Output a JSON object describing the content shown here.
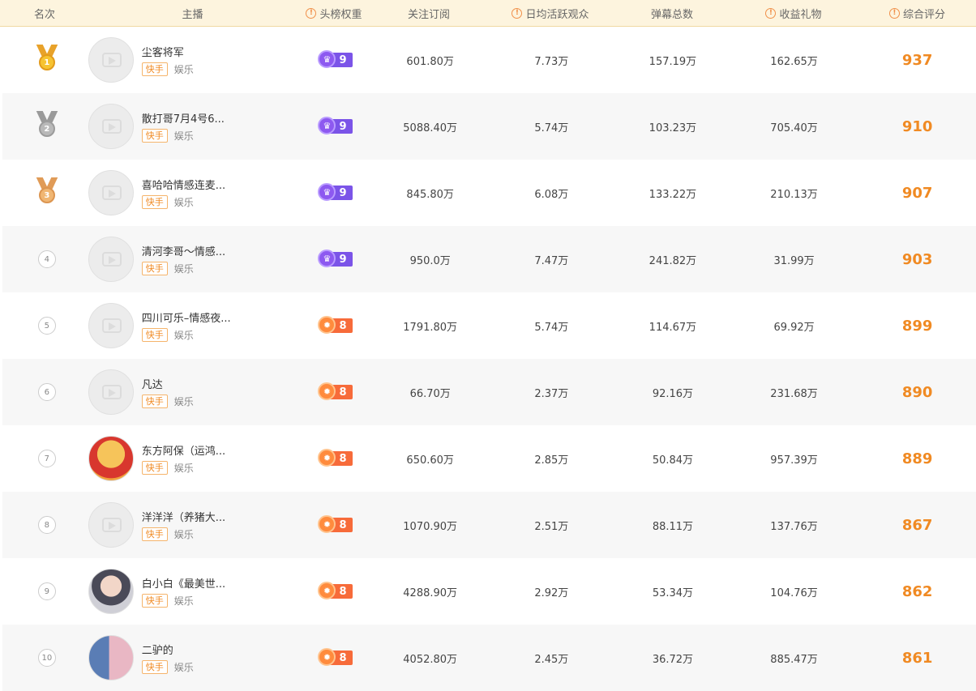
{
  "header": {
    "rank": "名次",
    "anchor": "主播",
    "weight": "头榜权重",
    "follow": "关注订阅",
    "daily": "日均活跃观众",
    "barrage": "弹幕总数",
    "income": "收益礼物",
    "score": "综合评分"
  },
  "colors": {
    "accent": "#f08a23",
    "header_bg": "#fdf4de",
    "badge_purple": "#7b54e8",
    "badge_orange": "#f76b3a",
    "gold": "#f2a823",
    "silver": "#a3a3a3",
    "bronze": "#eaa764"
  },
  "rows": [
    {
      "rank": "1",
      "name": "尘客将军",
      "platform": "快手",
      "category": "娱乐",
      "weight": "9",
      "follow": "601.80万",
      "daily": "7.73万",
      "barrage": "157.19万",
      "income": "162.65万",
      "score": "937"
    },
    {
      "rank": "2",
      "name": "散打哥7月4号6...",
      "platform": "快手",
      "category": "娱乐",
      "weight": "9",
      "follow": "5088.40万",
      "daily": "5.74万",
      "barrage": "103.23万",
      "income": "705.40万",
      "score": "910"
    },
    {
      "rank": "3",
      "name": "喜哈哈情感连麦...",
      "platform": "快手",
      "category": "娱乐",
      "weight": "9",
      "follow": "845.80万",
      "daily": "6.08万",
      "barrage": "133.22万",
      "income": "210.13万",
      "score": "907"
    },
    {
      "rank": "4",
      "name": "清河李哥～情感...",
      "platform": "快手",
      "category": "娱乐",
      "weight": "9",
      "follow": "950.0万",
      "daily": "7.47万",
      "barrage": "241.82万",
      "income": "31.99万",
      "score": "903"
    },
    {
      "rank": "5",
      "name": "四川可乐–情感夜...",
      "platform": "快手",
      "category": "娱乐",
      "weight": "8",
      "follow": "1791.80万",
      "daily": "5.74万",
      "barrage": "114.67万",
      "income": "69.92万",
      "score": "899"
    },
    {
      "rank": "6",
      "name": "凡达",
      "platform": "快手",
      "category": "娱乐",
      "weight": "8",
      "follow": "66.70万",
      "daily": "2.37万",
      "barrage": "92.16万",
      "income": "231.68万",
      "score": "890"
    },
    {
      "rank": "7",
      "name": "东方阿保（运鸿...",
      "platform": "快手",
      "category": "娱乐",
      "weight": "8",
      "follow": "650.60万",
      "daily": "2.85万",
      "barrage": "50.84万",
      "income": "957.39万",
      "score": "889"
    },
    {
      "rank": "8",
      "name": "洋洋洋（养猪大...",
      "platform": "快手",
      "category": "娱乐",
      "weight": "8",
      "follow": "1070.90万",
      "daily": "2.51万",
      "barrage": "88.11万",
      "income": "137.76万",
      "score": "867"
    },
    {
      "rank": "9",
      "name": "白小白《最美世...",
      "platform": "快手",
      "category": "娱乐",
      "weight": "8",
      "follow": "4288.90万",
      "daily": "2.92万",
      "barrage": "53.34万",
      "income": "104.76万",
      "score": "862"
    },
    {
      "rank": "10",
      "name": "二驴的",
      "platform": "快手",
      "category": "娱乐",
      "weight": "8",
      "follow": "4052.80万",
      "daily": "2.45万",
      "barrage": "36.72万",
      "income": "885.47万",
      "score": "861"
    }
  ]
}
